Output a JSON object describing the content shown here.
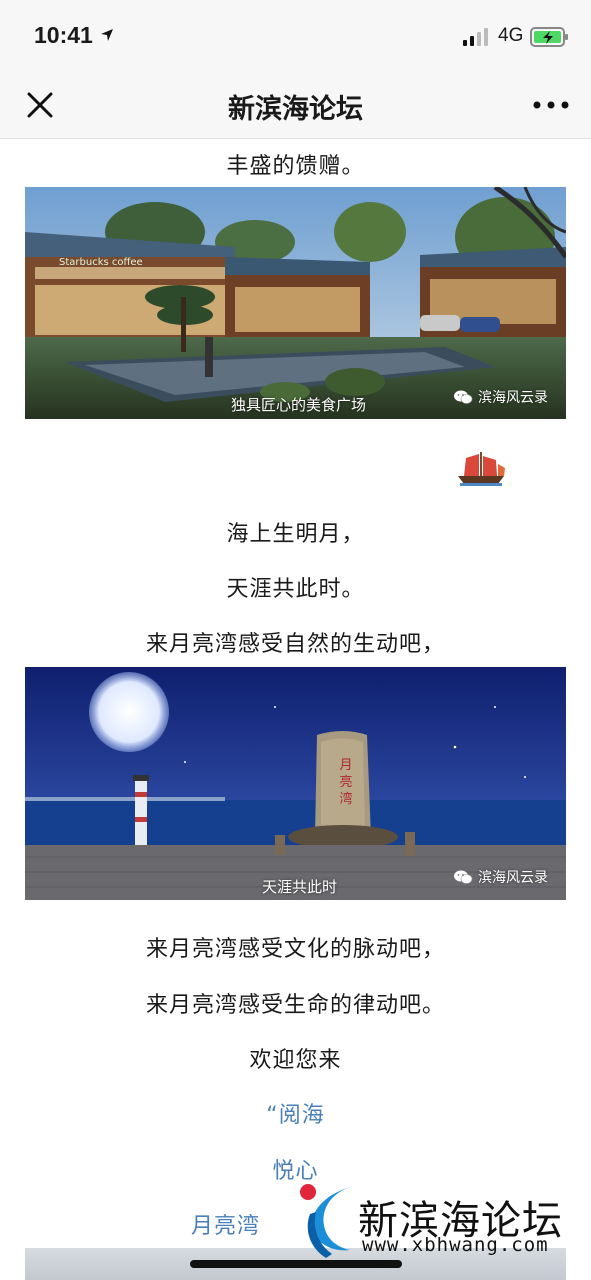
{
  "status_bar": {
    "time": "10:41",
    "network": "4G"
  },
  "nav": {
    "title": "新滨海论坛"
  },
  "article": {
    "line_top": "丰盛的馈赠。",
    "image1_caption": "独具匠心的美食广场",
    "image1_sign": "Starbucks coffee",
    "watermark": "滨海风云录",
    "poem_line1": "海上生明月，",
    "poem_line2": "天涯共此时。",
    "line_nature": "来月亮湾感受自然的生动吧，",
    "image2_caption": "天涯共此时",
    "image2_stone": "月亮湾",
    "line_culture": "来月亮湾感受文化的脉动吧，",
    "line_life": "来月亮湾感受生命的律动吧。",
    "welcome": "欢迎您来",
    "link1": "“阅海",
    "link2": "悦心",
    "link3": "月亮湾"
  },
  "brand": {
    "name": "新滨海论坛",
    "url": "www.xbhwang.com"
  },
  "colors": {
    "link": "#4a7fb8",
    "nav_bg": "#f7f7f7",
    "battery": "#4cd964"
  }
}
